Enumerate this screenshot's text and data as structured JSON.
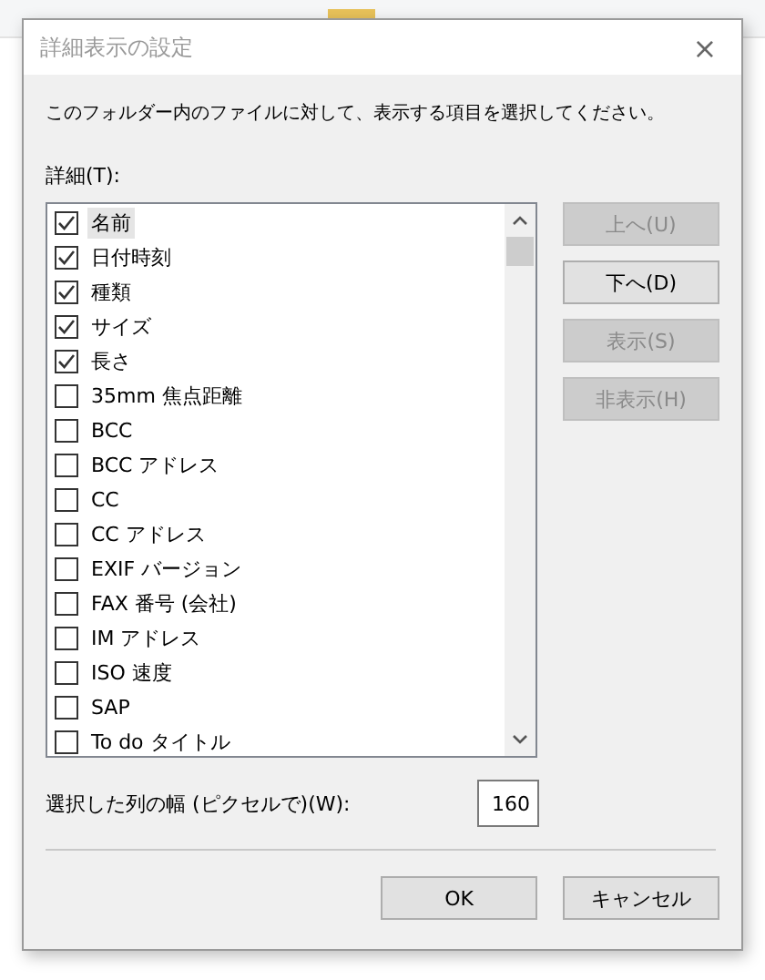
{
  "window": {
    "title": "詳細表示の設定",
    "close": "×"
  },
  "instruction": "このフォルダー内のファイルに対して、表示する項目を選択してください。",
  "details_label": "詳細(T):",
  "items": [
    {
      "label": "名前",
      "checked": true,
      "selected": true
    },
    {
      "label": "日付時刻",
      "checked": true,
      "selected": false
    },
    {
      "label": "種類",
      "checked": true,
      "selected": false
    },
    {
      "label": "サイズ",
      "checked": true,
      "selected": false
    },
    {
      "label": "長さ",
      "checked": true,
      "selected": false
    },
    {
      "label": "35mm 焦点距離",
      "checked": false,
      "selected": false
    },
    {
      "label": "BCC",
      "checked": false,
      "selected": false
    },
    {
      "label": "BCC アドレス",
      "checked": false,
      "selected": false
    },
    {
      "label": "CC",
      "checked": false,
      "selected": false
    },
    {
      "label": "CC アドレス",
      "checked": false,
      "selected": false
    },
    {
      "label": "EXIF バージョン",
      "checked": false,
      "selected": false
    },
    {
      "label": "FAX 番号 (会社)",
      "checked": false,
      "selected": false
    },
    {
      "label": "IM アドレス",
      "checked": false,
      "selected": false
    },
    {
      "label": "ISO 速度",
      "checked": false,
      "selected": false
    },
    {
      "label": "SAP",
      "checked": false,
      "selected": false
    },
    {
      "label": "To do タイトル",
      "checked": false,
      "selected": false
    }
  ],
  "side_buttons": [
    {
      "label": "上へ(U)",
      "disabled": true
    },
    {
      "label": "下へ(D)",
      "disabled": false
    },
    {
      "label": "表示(S)",
      "disabled": true
    },
    {
      "label": "非表示(H)",
      "disabled": true
    }
  ],
  "width_label": "選択した列の幅 (ピクセルで)(W):",
  "width_value": "160",
  "footer_buttons": [
    {
      "label": "OK"
    },
    {
      "label": "キャンセル"
    }
  ]
}
